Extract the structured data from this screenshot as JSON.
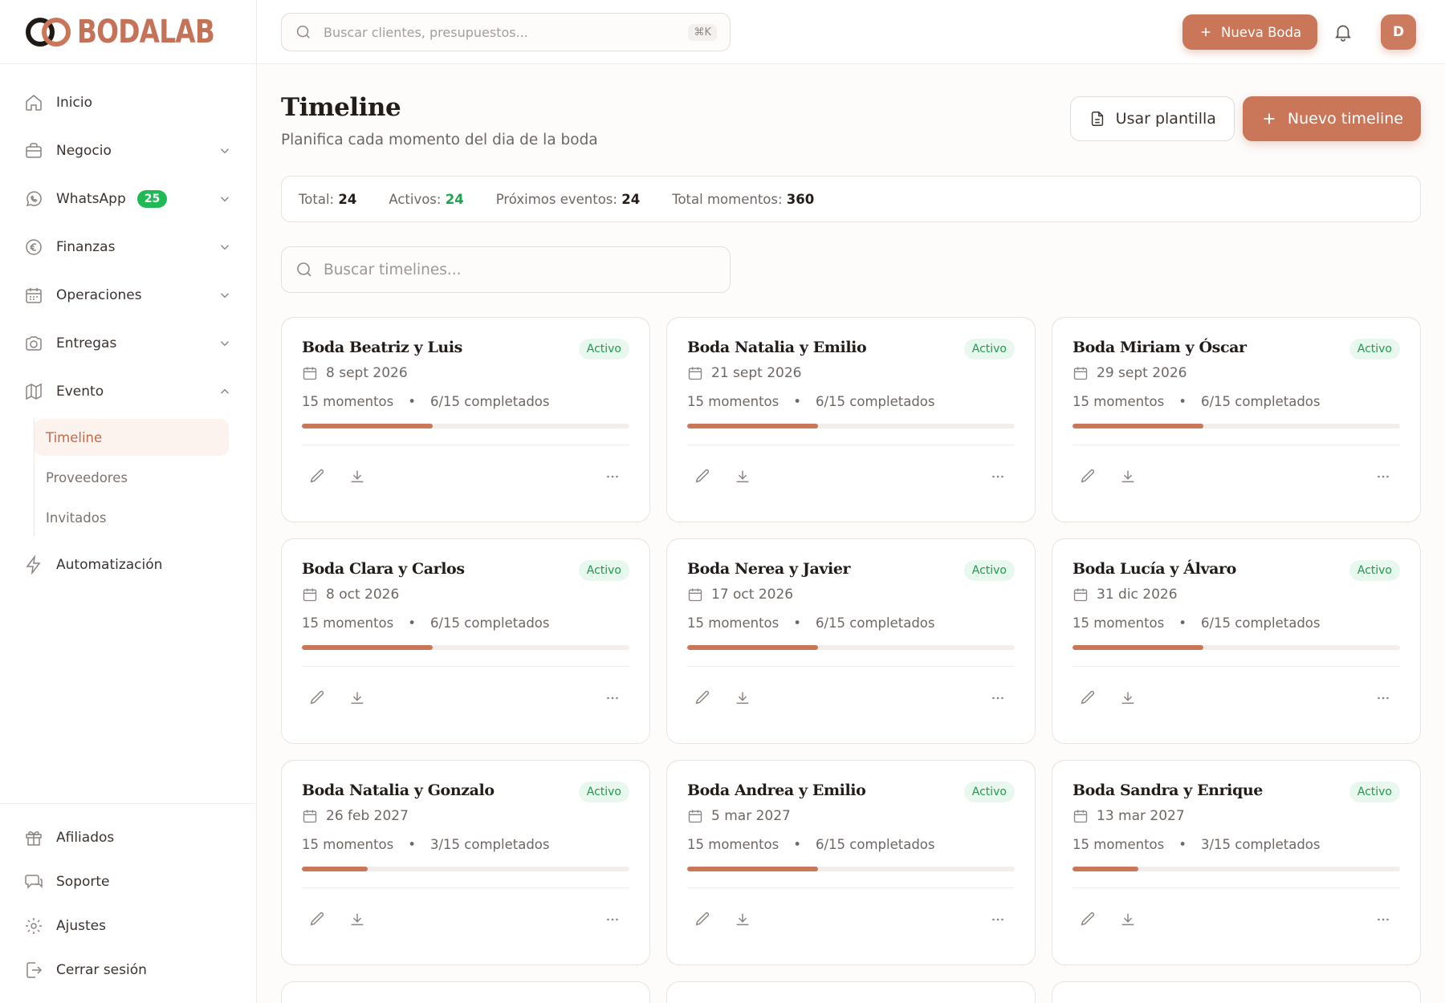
{
  "brand": {
    "name": "BODALAB",
    "accent": "#c97659"
  },
  "sidebar": {
    "items": [
      {
        "label": "Inicio",
        "icon": "home-icon"
      },
      {
        "label": "Negocio",
        "icon": "briefcase-icon"
      },
      {
        "label": "WhatsApp",
        "icon": "whatsapp-icon",
        "badge": "25"
      },
      {
        "label": "Finanzas",
        "icon": "euro-icon"
      },
      {
        "label": "Operaciones",
        "icon": "calendar-icon"
      },
      {
        "label": "Entregas",
        "icon": "camera-icon"
      },
      {
        "label": "Evento",
        "icon": "map-icon"
      },
      {
        "label": "Automatización",
        "icon": "bolt-icon"
      }
    ],
    "evento_sub": [
      {
        "label": "Timeline",
        "active": true
      },
      {
        "label": "Proveedores"
      },
      {
        "label": "Invitados"
      }
    ],
    "bottom": [
      {
        "label": "Afiliados",
        "icon": "gift-icon"
      },
      {
        "label": "Soporte",
        "icon": "chat-icon"
      },
      {
        "label": "Ajustes",
        "icon": "gear-icon"
      },
      {
        "label": "Cerrar sesión",
        "icon": "logout-icon"
      }
    ]
  },
  "topbar": {
    "search_placeholder": "Buscar clientes, presupuestos...",
    "shortcut": "⌘K",
    "new_wedding_label": "Nueva Boda",
    "avatar_initial": "D"
  },
  "page": {
    "title": "Timeline",
    "subtitle": "Planifica cada momento del dia de la boda",
    "template_button": "Usar plantilla",
    "new_button": "Nuevo timeline",
    "search_placeholder": "Buscar timelines..."
  },
  "stats": {
    "total_label": "Total:",
    "total_value": "24",
    "active_label": "Activos:",
    "active_value": "24",
    "upcoming_label": "Próximos eventos:",
    "upcoming_value": "24",
    "moments_label": "Total momentos:",
    "moments_value": "360"
  },
  "cards": [
    {
      "title": "Boda Beatriz y Luis",
      "status": "Activo",
      "date": "8 sept 2026",
      "moments": "15 momentos",
      "completed": "6/15 completados",
      "progress": 0.4
    },
    {
      "title": "Boda Natalia y Emilio",
      "status": "Activo",
      "date": "21 sept 2026",
      "moments": "15 momentos",
      "completed": "6/15 completados",
      "progress": 0.4
    },
    {
      "title": "Boda Miriam y Óscar",
      "status": "Activo",
      "date": "29 sept 2026",
      "moments": "15 momentos",
      "completed": "6/15 completados",
      "progress": 0.4
    },
    {
      "title": "Boda Clara y Carlos",
      "status": "Activo",
      "date": "8 oct 2026",
      "moments": "15 momentos",
      "completed": "6/15 completados",
      "progress": 0.4
    },
    {
      "title": "Boda Nerea y Javier",
      "status": "Activo",
      "date": "17 oct 2026",
      "moments": "15 momentos",
      "completed": "6/15 completados",
      "progress": 0.4
    },
    {
      "title": "Boda Lucía y Álvaro",
      "status": "Activo",
      "date": "31 dic 2026",
      "moments": "15 momentos",
      "completed": "6/15 completados",
      "progress": 0.4
    },
    {
      "title": "Boda Natalia y Gonzalo",
      "status": "Activo",
      "date": "26 feb 2027",
      "moments": "15 momentos",
      "completed": "3/15 completados",
      "progress": 0.2
    },
    {
      "title": "Boda Andrea y Emilio",
      "status": "Activo",
      "date": "5 mar 2027",
      "moments": "15 momentos",
      "completed": "6/15 completados",
      "progress": 0.4
    },
    {
      "title": "Boda Sandra y Enrique",
      "status": "Activo",
      "date": "13 mar 2027",
      "moments": "15 momentos",
      "completed": "3/15 completados",
      "progress": 0.2
    }
  ]
}
